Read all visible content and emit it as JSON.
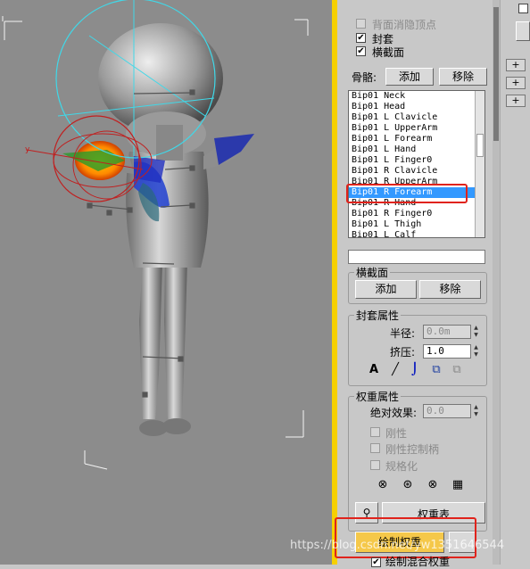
{
  "display_options": {
    "backface_cull": "背面消隐顶点",
    "envelopes": "封套",
    "cross_sections": "横截面"
  },
  "bones": {
    "label": "骨骼:",
    "add": "添加",
    "remove": "移除",
    "items": [
      "Bip01 Neck",
      "Bip01 Head",
      "Bip01 L Clavicle",
      "Bip01 L UpperArm",
      "Bip01 L Forearm",
      "Bip01 L Hand",
      "Bip01 L Finger0",
      "Bip01 R Clavicle",
      "Bip01 R UpperArm",
      "Bip01 R Forearm",
      "Bip01 R Hand",
      "Bip01 R Finger0",
      "Bip01 L Thigh",
      "Bip01 L Calf"
    ],
    "selected_index": 9
  },
  "cross_section": {
    "title": "横截面",
    "add": "添加",
    "remove": "移除"
  },
  "envelope_props": {
    "title": "封套属性",
    "radius_label": "半径:",
    "radius_value": "0.0m",
    "squash_label": "挤压:",
    "squash_value": "1.0"
  },
  "weight_props": {
    "title": "权重属性",
    "abs_effect_label": "绝对效果:",
    "abs_effect_value": "0.0",
    "rigid": "刚性",
    "rigid_handles": "刚性控制柄",
    "normalize": "规格化",
    "weight_table": "权重表",
    "paint_weights": "绘制权重",
    "paint_blend": "绘制混合权重"
  },
  "watermark": "https://blog.csdn.net/yw1351646544",
  "colors": {
    "selection": "#3399ff",
    "viewport_border": "#f6d000",
    "highlight_box": "#e0231c",
    "paint_button": "#f5c84a"
  },
  "icons": [
    "text-a-icon",
    "pen-icon",
    "curve-icon",
    "copy-icon",
    "paste-icon",
    "exclude-icon",
    "select-verts-icon",
    "include-icon",
    "film-icon",
    "wrench-icon"
  ]
}
